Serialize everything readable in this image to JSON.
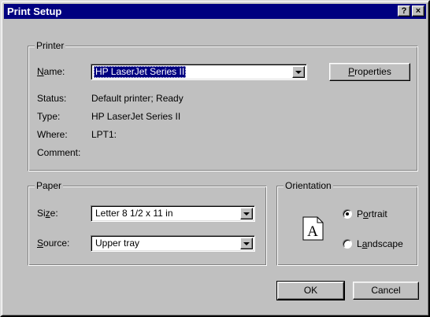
{
  "dialog": {
    "title": "Print Setup",
    "help_button": "?",
    "close_button": "×"
  },
  "printer": {
    "group_label": "Printer",
    "name_label_underlined": "N",
    "name_label_rest": "ame:",
    "selected_printer": "HP LaserJet Series II",
    "properties_underlined": "P",
    "properties_rest": "roperties",
    "status_label": "Status:",
    "status_value": "Default printer; Ready",
    "type_label": "Type:",
    "type_value": "HP LaserJet Series II",
    "where_label": "Where:",
    "where_value": "LPT1:",
    "comment_label": "Comment:"
  },
  "paper": {
    "group_label": "Paper",
    "size_label_before": "Si",
    "size_label_underlined": "z",
    "size_label_after": "e:",
    "size_value": "Letter 8 1/2 x 11 in",
    "source_label_underlined": "S",
    "source_label_rest": "ource:",
    "source_value": "Upper tray"
  },
  "orientation": {
    "group_label": "Orientation",
    "page_glyph": "A",
    "portrait_before": "P",
    "portrait_underlined": "o",
    "portrait_after": "rtrait",
    "landscape_before": "L",
    "landscape_underlined": "a",
    "landscape_after": "ndscape",
    "selected": "portrait"
  },
  "buttons": {
    "ok": "OK",
    "cancel": "Cancel"
  },
  "colors": {
    "title_bar": "#000080",
    "face": "#c0c0c0",
    "selection": "#000080"
  }
}
